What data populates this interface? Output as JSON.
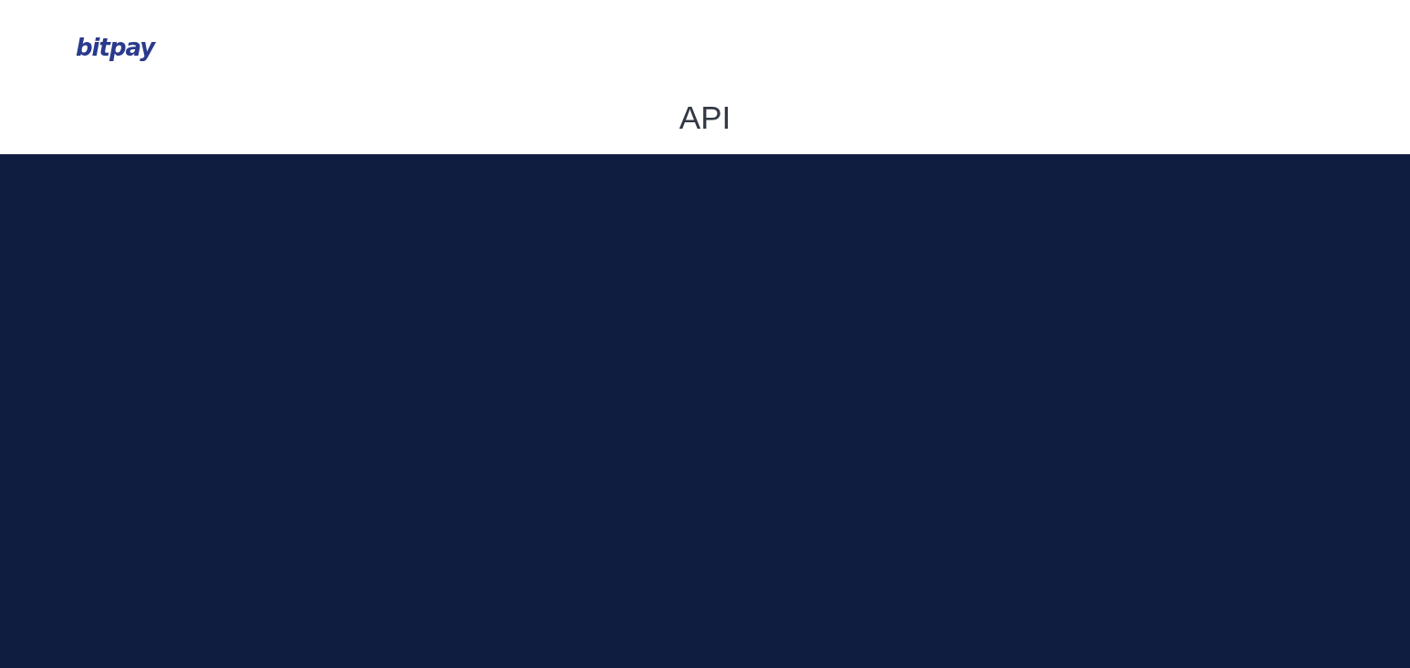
{
  "header": {
    "logo": "bitpay"
  },
  "page_title": "API"
}
